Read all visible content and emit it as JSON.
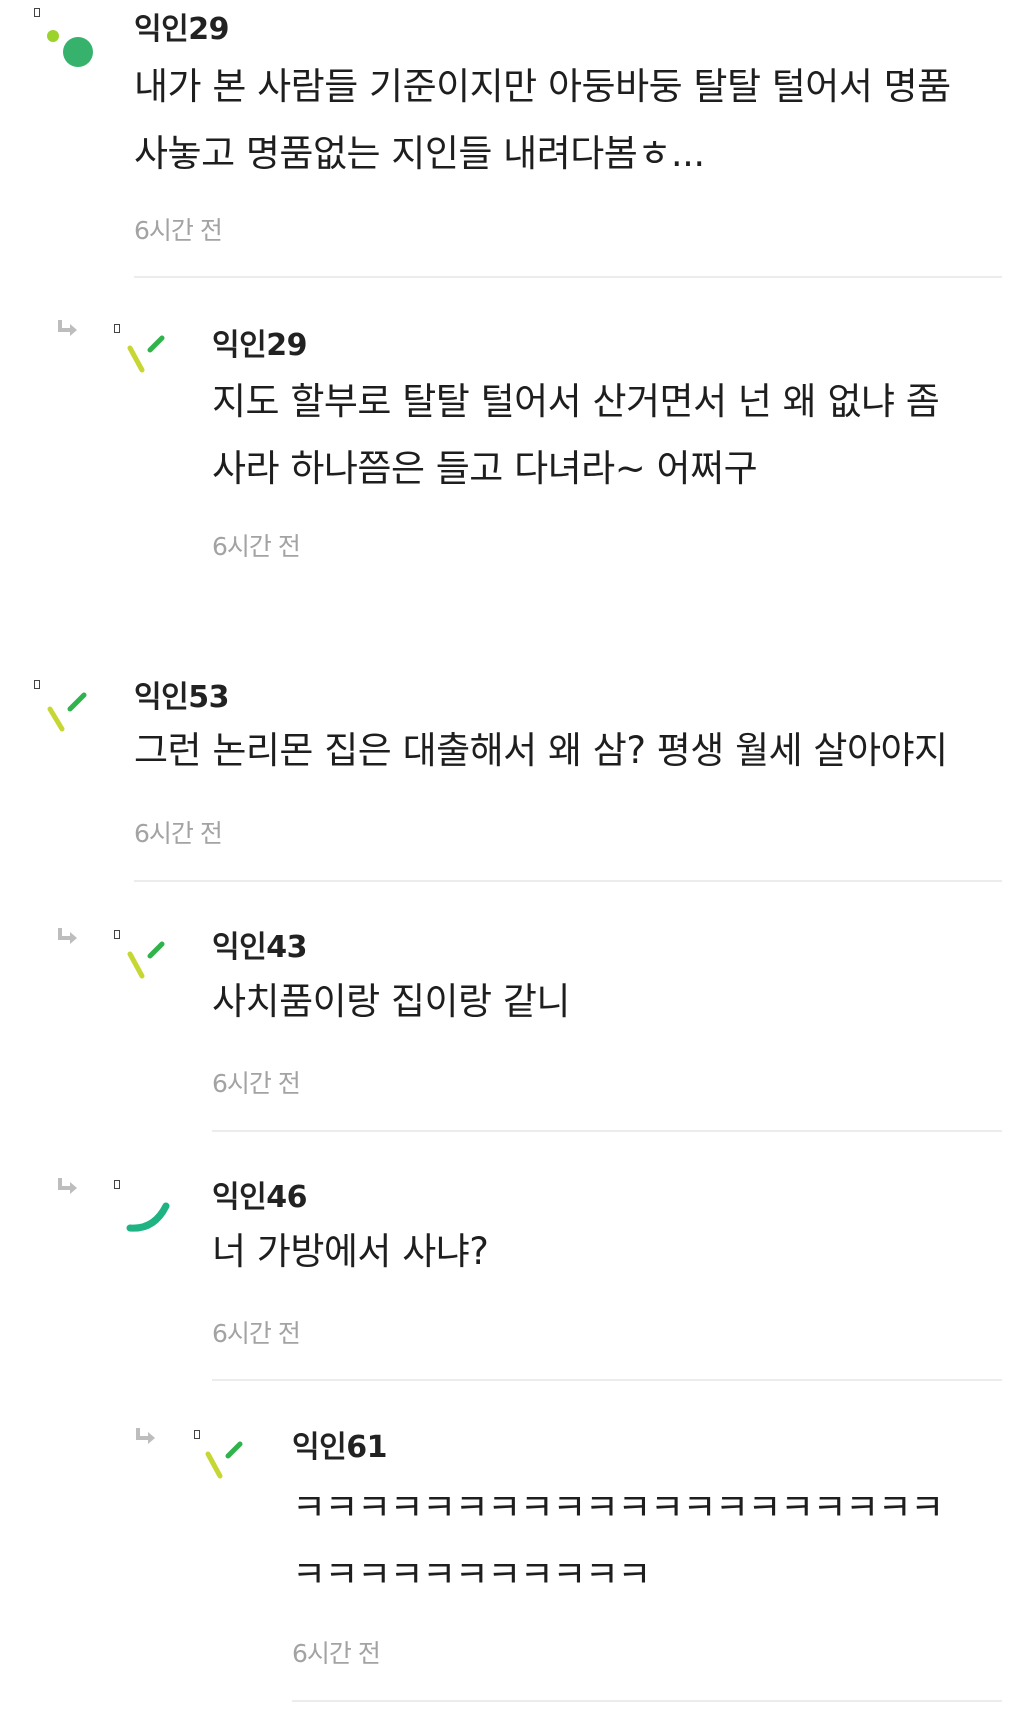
{
  "comments": [
    {
      "author": "익인29",
      "lines": [
        "내가 본 사람들 기준이지만 아둥바둥 탈탈 털어서 명품",
        "사놓고 명품없는 지인들 내려다봄ㅎ..."
      ],
      "time": "6시간 전",
      "is_reply": false,
      "avatar_icon": "green-dots-avatar-icon"
    },
    {
      "author": "익인29",
      "lines": [
        "지도 할부로 탈탈 털어서 산거면서 넌 왜 없냐 좀",
        "사라 하나쯤은 들고 다녀라~ 어쩌구"
      ],
      "time": "6시간 전",
      "is_reply": true,
      "avatar_icon": "green-dashes-avatar-icon"
    },
    {
      "author": "익인53",
      "lines": [
        "그런 논리몬 집은 대출해서 왜 삼? 평생 월세 살아야지"
      ],
      "time": "6시간 전",
      "is_reply": false,
      "avatar_icon": "green-dashes-avatar-icon"
    },
    {
      "author": "익인43",
      "lines": [
        "사치품이랑 집이랑 같니"
      ],
      "time": "6시간 전",
      "is_reply": true,
      "avatar_icon": "green-dashes-avatar-icon"
    },
    {
      "author": "익인46",
      "lines": [
        "너 가방에서 사냐?"
      ],
      "time": "6시간 전",
      "is_reply": true,
      "avatar_icon": "green-arc-avatar-icon"
    },
    {
      "author": "익인61",
      "lines": [
        "ㅋㅋㅋㅋㅋㅋㅋㅋㅋㅋㅋㅋㅋㅋㅋㅋㅋㅋㅋㅋ",
        "ㅋㅋㅋㅋㅋㅋㅋㅋㅋㅋㅋ"
      ],
      "time": "6시간 전",
      "is_reply": true,
      "avatar_icon": "green-dashes-avatar-icon"
    }
  ],
  "colors": {
    "avatar_green": "#37b26c",
    "avatar_lime": "#9bd22b",
    "avatar_yellow": "#c6d734",
    "time_gray": "#a3a3a3",
    "divider": "#ececec"
  }
}
